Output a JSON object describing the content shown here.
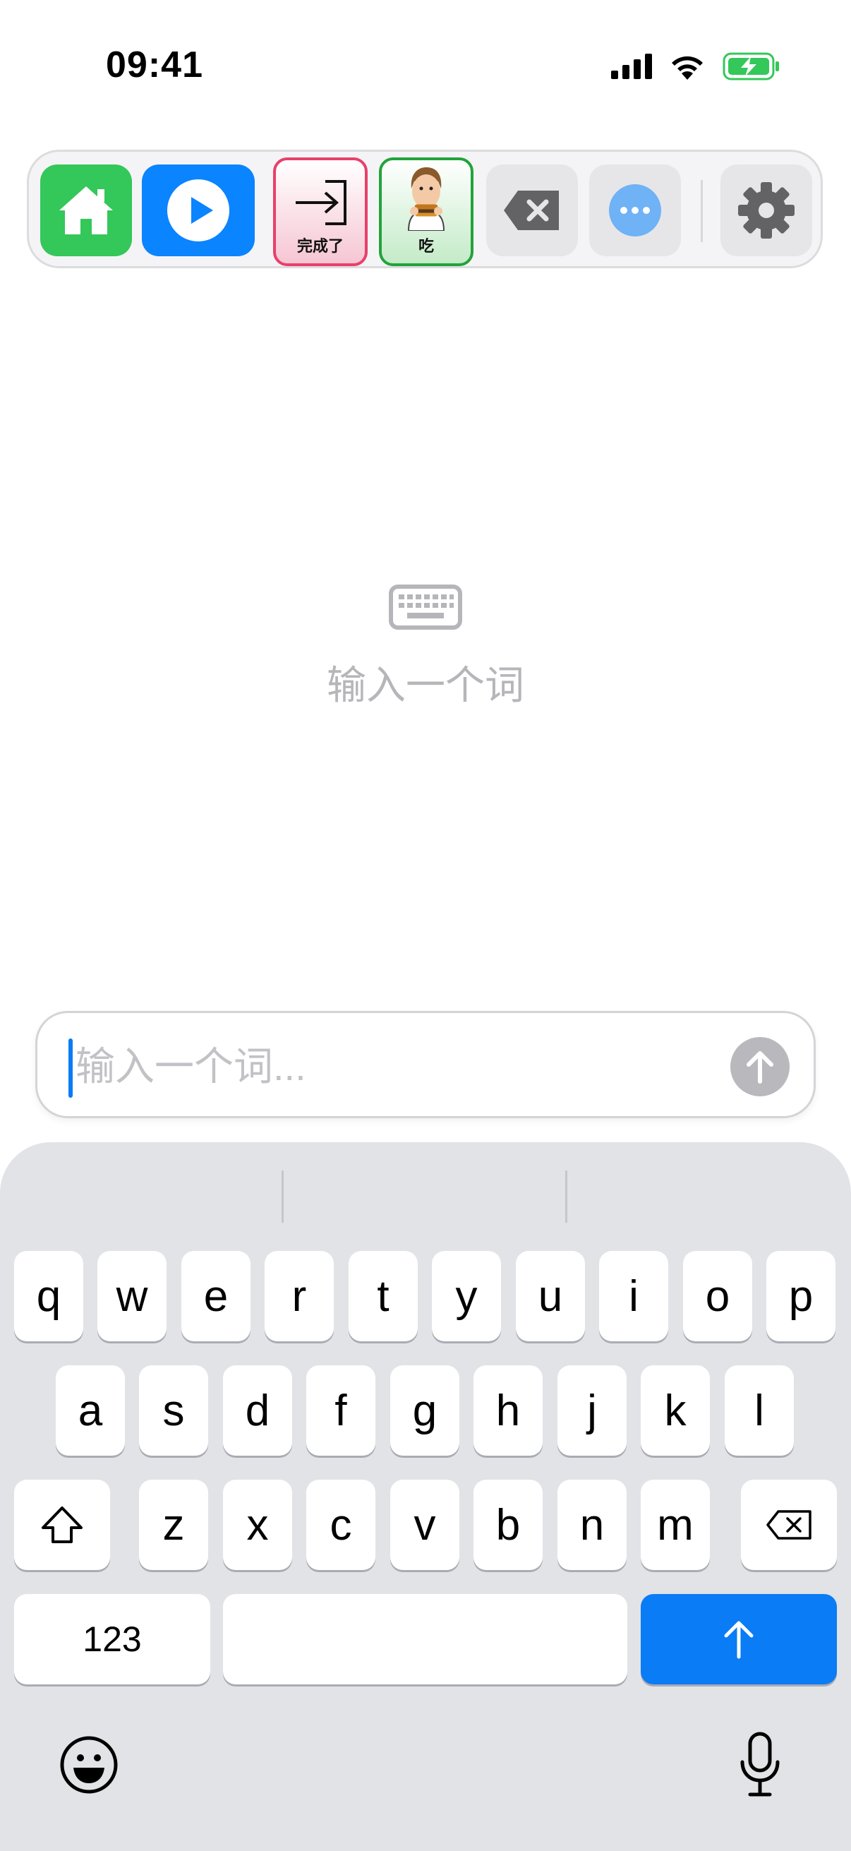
{
  "status_bar": {
    "time": "09:41",
    "icons": [
      "cellular-signal-icon",
      "wifi-icon",
      "battery-charging-icon"
    ]
  },
  "toolbar": {
    "buttons": [
      {
        "name": "home",
        "icon": "home-icon",
        "color": "#34c759"
      },
      {
        "name": "play",
        "icon": "play-icon",
        "color": "#0a84ff"
      },
      {
        "name": "done",
        "label": "完成了",
        "icon": "arrow-into-bracket-icon",
        "border": "#e8406a"
      },
      {
        "name": "eat",
        "label": "吃",
        "icon": "person-eating-burger-icon",
        "border": "#22a33a"
      },
      {
        "name": "delete",
        "icon": "delete-left-icon"
      },
      {
        "name": "more",
        "icon": "ellipsis-circle-icon"
      },
      {
        "name": "settings",
        "icon": "gear-icon"
      }
    ]
  },
  "empty_state": {
    "icon": "keyboard-icon",
    "text": "输入一个词"
  },
  "input": {
    "placeholder": "输入一个词...",
    "value": "",
    "send_icon": "arrow-up-circle-icon"
  },
  "keyboard": {
    "row1": [
      "q",
      "w",
      "e",
      "r",
      "t",
      "y",
      "u",
      "i",
      "o",
      "p"
    ],
    "row2": [
      "a",
      "s",
      "d",
      "f",
      "g",
      "h",
      "j",
      "k",
      "l"
    ],
    "row3": [
      "z",
      "x",
      "c",
      "v",
      "b",
      "n",
      "m"
    ],
    "numbers_label": "123",
    "return_icon": "arrow-up-icon",
    "accent": "#0a7cf5"
  }
}
